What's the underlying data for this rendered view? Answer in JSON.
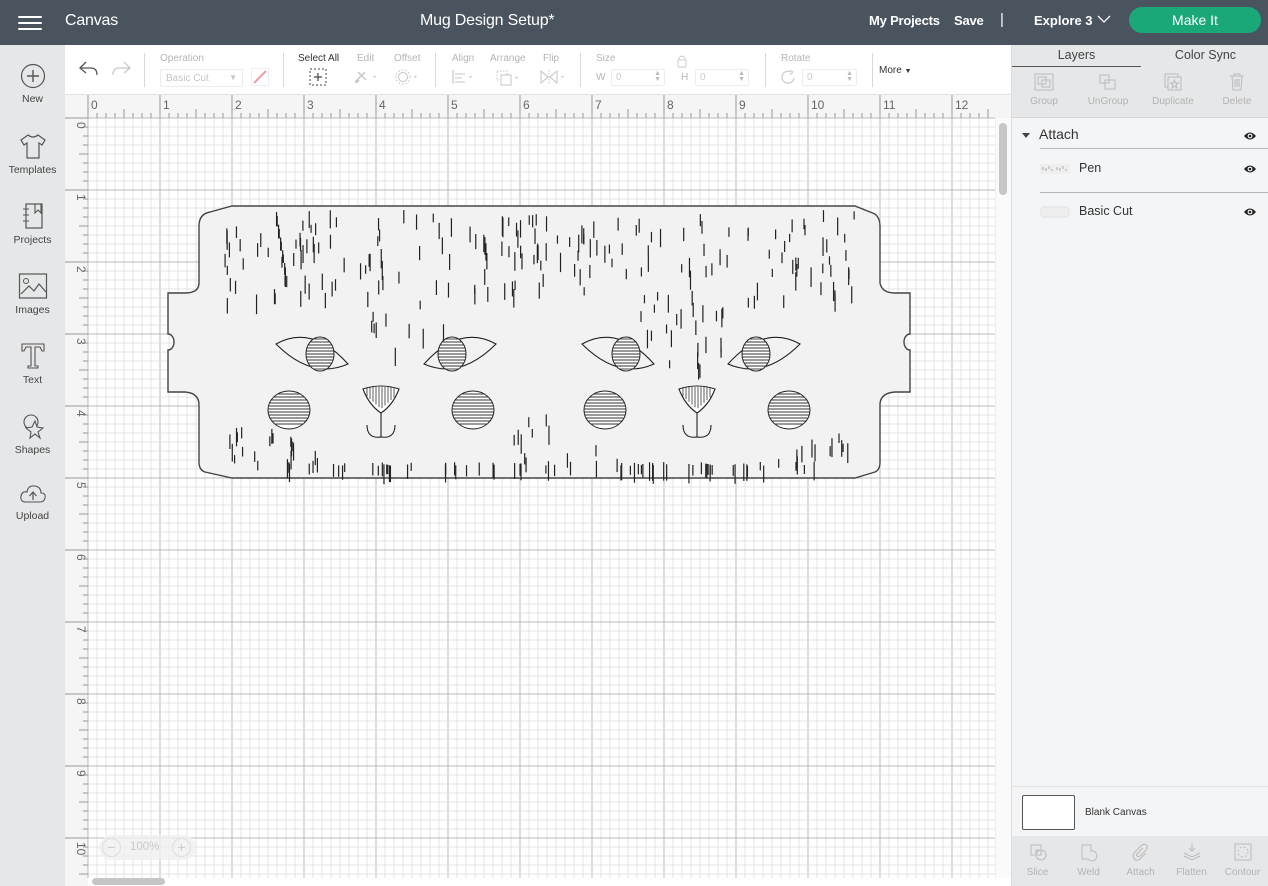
{
  "topbar": {
    "menu_icon": "hamburger-icon",
    "app_title": "Canvas",
    "document_title": "Mug Design Setup*",
    "my_projects": "My Projects",
    "save": "Save",
    "separator": "|",
    "machine": "Explore 3",
    "make_it": "Make It",
    "accent_color": "#1aa879",
    "bar_color": "#4a545e"
  },
  "leftnav": {
    "items": [
      {
        "label": "New",
        "icon": "plus-circle-icon"
      },
      {
        "label": "Templates",
        "icon": "tshirt-icon"
      },
      {
        "label": "Projects",
        "icon": "notebook-icon"
      },
      {
        "label": "Images",
        "icon": "image-icon"
      },
      {
        "label": "Text",
        "icon": "text-T-icon"
      },
      {
        "label": "Shapes",
        "icon": "shapes-icon"
      },
      {
        "label": "Upload",
        "icon": "cloud-upload-icon"
      }
    ]
  },
  "toolbar": {
    "undo_icon": "undo-icon",
    "redo_icon": "redo-icon",
    "operation_label": "Operation",
    "operation_value": "Basic Cut",
    "select_all": "Select All",
    "edit": "Edit",
    "offset": "Offset",
    "align": "Align",
    "arrange": "Arrange",
    "flip": "Flip",
    "size": "Size",
    "w_label": "W",
    "w_value": "0",
    "h_label": "H",
    "h_value": "0",
    "rotate": "Rotate",
    "rotate_value": "0",
    "more": "More"
  },
  "canvas": {
    "ruler_top": [
      "0",
      "1",
      "2",
      "3",
      "4",
      "5",
      "6",
      "7",
      "8",
      "9",
      "10",
      "11",
      "12"
    ],
    "ruler_left": [
      "0",
      "1",
      "2",
      "3",
      "4",
      "5",
      "6",
      "7",
      "8",
      "9",
      "10"
    ],
    "zoom_level": "100%",
    "zoom_out": "−",
    "zoom_in": "+",
    "units": "in"
  },
  "rightpanel": {
    "tabs": [
      "Layers",
      "Color Sync"
    ],
    "actions": [
      "Group",
      "UnGroup",
      "Duplicate",
      "Delete"
    ],
    "group_name": "Attach",
    "layers": [
      {
        "name": "Pen"
      },
      {
        "name": "Basic Cut"
      }
    ],
    "blank_canvas": "Blank Canvas",
    "bottom_actions": [
      "Slice",
      "Weld",
      "Attach",
      "Flatten",
      "Contour"
    ]
  }
}
